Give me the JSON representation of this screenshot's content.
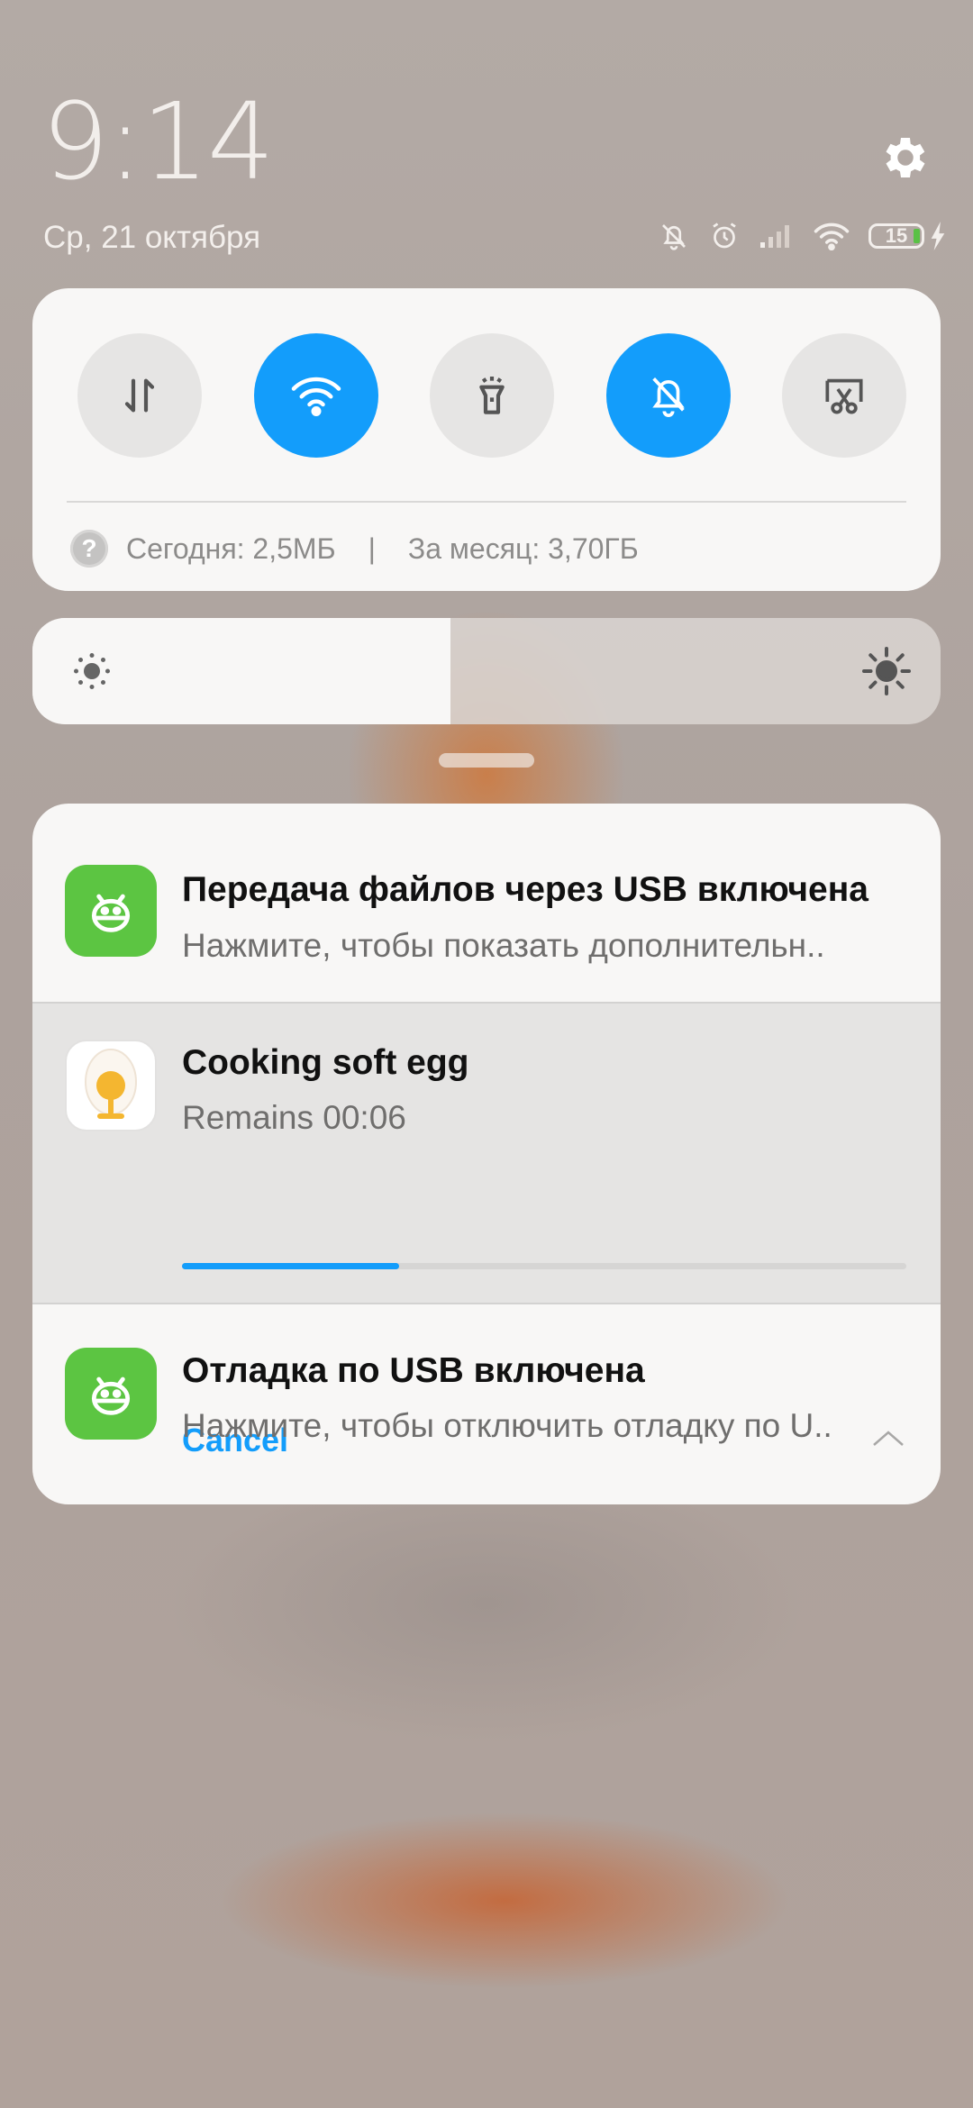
{
  "status": {
    "time": "9:14",
    "date": "Ср, 21 октября",
    "battery_level": "15",
    "icons": [
      "gear-icon",
      "bell-off-icon",
      "alarm-icon",
      "signal-icon",
      "wifi-icon",
      "battery-icon",
      "charging-icon"
    ]
  },
  "quick_settings": {
    "toggles": [
      {
        "name": "mobile-data-toggle",
        "icon": "data-arrows-icon",
        "on": false
      },
      {
        "name": "wifi-toggle",
        "icon": "wifi-icon",
        "on": true
      },
      {
        "name": "flashlight-toggle",
        "icon": "flashlight-icon",
        "on": false
      },
      {
        "name": "silent-toggle",
        "icon": "bell-off-icon",
        "on": true
      },
      {
        "name": "screenshot-toggle",
        "icon": "scissors-icon",
        "on": false
      }
    ],
    "usage_today": "Сегодня: 2,5МБ",
    "usage_separator": "|",
    "usage_month": "За месяц: 3,70ГБ"
  },
  "brightness": {
    "level": 0.46
  },
  "notifications": [
    {
      "title": "Передача файлов через USB включена",
      "text": "Нажмите, чтобы показать дополнительн..",
      "icon": "android-icon"
    },
    {
      "title": "Cooking soft egg",
      "text": "Remains 00:06",
      "progress": 0.3,
      "action": "Cancel",
      "icon": "egg-icon"
    },
    {
      "title": "Отладка по USB включена",
      "text": "Нажмите, чтобы отключить отладку по U..",
      "icon": "android-icon"
    }
  ],
  "colors": {
    "accent": "#139dfb",
    "android_green": "#5cc542"
  }
}
